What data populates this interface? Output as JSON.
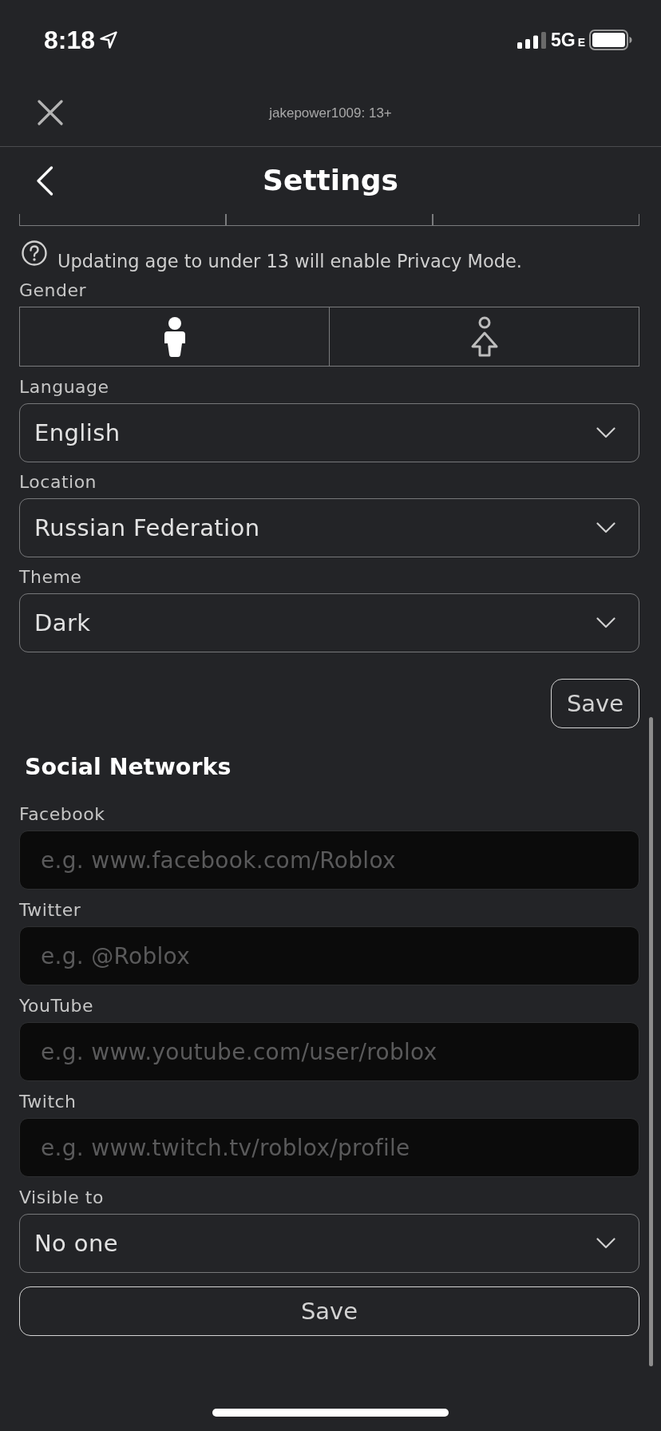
{
  "status_bar": {
    "time": "8:18",
    "network": "5G",
    "network_suffix": "E"
  },
  "top_bar": {
    "account": "jakepower1009: 13+"
  },
  "header": {
    "title": "Settings"
  },
  "privacy_note": "Updating age to under 13 will enable Privacy Mode.",
  "gender": {
    "label": "Gender",
    "options": [
      {
        "kind": "male",
        "selected": true
      },
      {
        "kind": "female",
        "selected": false
      }
    ]
  },
  "account_fields": [
    {
      "label": "Language",
      "value": "English"
    },
    {
      "label": "Location",
      "value": "Russian Federation"
    },
    {
      "label": "Theme",
      "value": "Dark"
    }
  ],
  "account_save_button": "Save",
  "social_networks": {
    "title": "Social Networks",
    "fields": [
      {
        "label": "Facebook",
        "placeholder": "e.g. www.facebook.com/Roblox"
      },
      {
        "label": "Twitter",
        "placeholder": "e.g. @Roblox"
      },
      {
        "label": "YouTube",
        "placeholder": "e.g. www.youtube.com/user/roblox"
      },
      {
        "label": "Twitch",
        "placeholder": "e.g. www.twitch.tv/roblox/profile"
      }
    ],
    "visibility": {
      "label": "Visible to",
      "value": "No one"
    },
    "save_button": "Save"
  }
}
